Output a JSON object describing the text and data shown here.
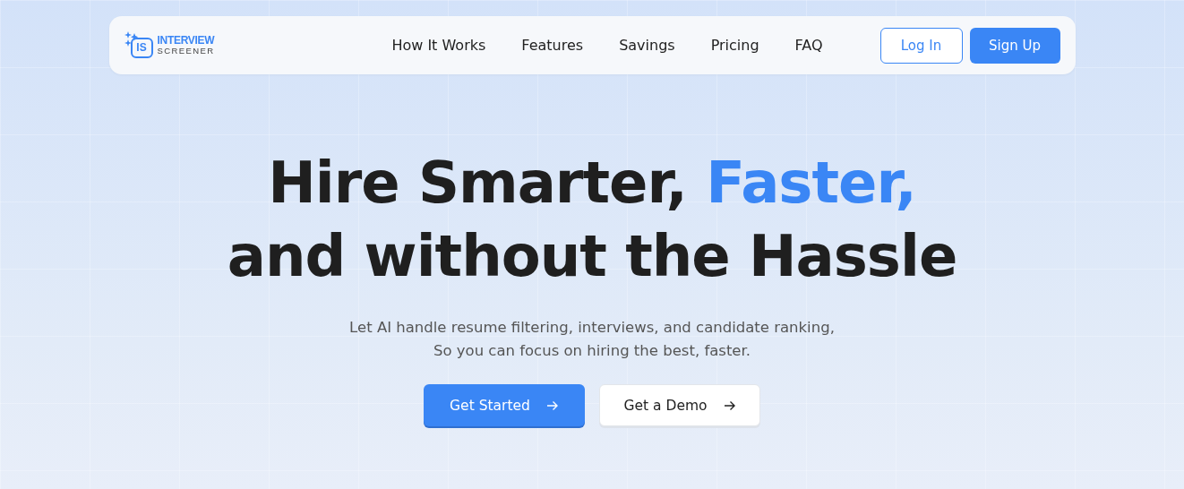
{
  "logo": {
    "badge": "IS",
    "line1": "INTERVIEW",
    "line2": "SCREENER"
  },
  "nav": [
    {
      "label": "How It Works"
    },
    {
      "label": "Features"
    },
    {
      "label": "Savings"
    },
    {
      "label": "Pricing"
    },
    {
      "label": "FAQ"
    }
  ],
  "auth": {
    "login": "Log In",
    "signup": "Sign Up"
  },
  "hero": {
    "title_start": "Hire Smarter, ",
    "title_highlight": "Faster,",
    "title_end": "and without the Hassle",
    "subtitle": [
      "Let AI handle resume filtering, interviews, and candidate ranking,",
      "So you can focus on hiring the best, faster."
    ]
  },
  "cta": [
    {
      "label": "Get Started",
      "kind": "primary"
    },
    {
      "label": "Get a Demo",
      "kind": "secondary"
    }
  ]
}
